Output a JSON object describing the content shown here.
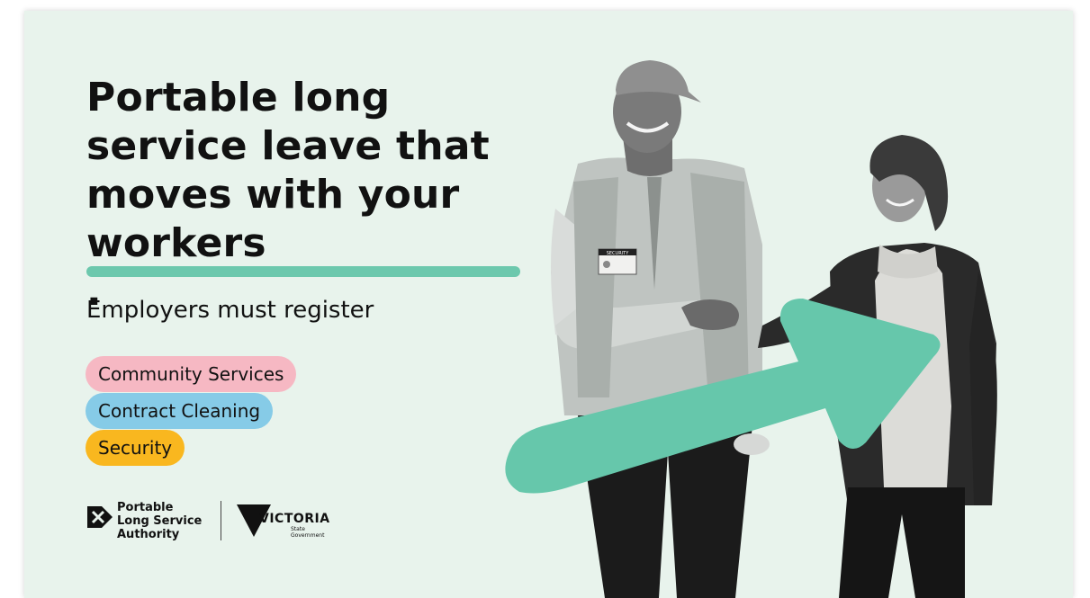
{
  "headline": {
    "lines": [
      "Portable long",
      "service leave that",
      "moves with your"
    ],
    "emphasis": "workers",
    "end_punct": "."
  },
  "subhead": "Employers must register",
  "industries": [
    {
      "label": "Community Services",
      "color": "#f6b8c3"
    },
    {
      "label": "Contract Cleaning",
      "color": "#86cbe7"
    },
    {
      "label": "Security",
      "color": "#f9b71f"
    }
  ],
  "logos": {
    "plsa": {
      "lines": [
        "Portable",
        "Long Service",
        "Authority"
      ]
    },
    "victoria": {
      "word": "VICTORIA",
      "sub": [
        "State",
        "Government"
      ]
    }
  },
  "photo": {
    "badge_text": "SECURITY",
    "arrow_color": "#66c7ab",
    "background": "#e8f3ec"
  }
}
